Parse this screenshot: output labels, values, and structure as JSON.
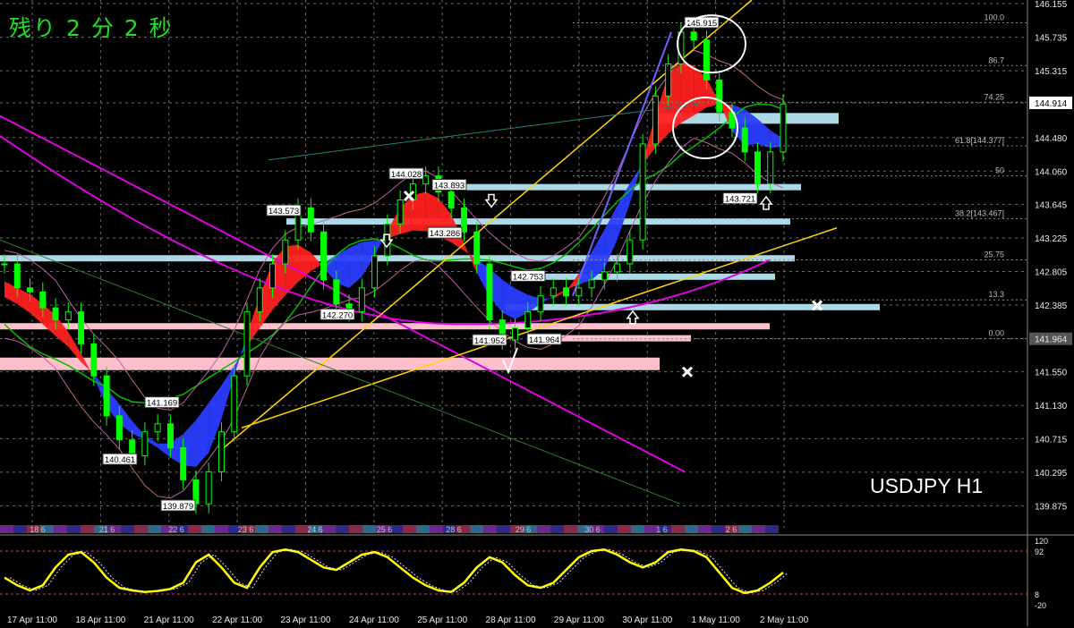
{
  "countdown": {
    "prefix": "残り",
    "minutes": "2",
    "min_unit": "分",
    "seconds": "2",
    "sec_unit": "秒"
  },
  "symbol_label": "USDJPY H1",
  "chart_data": {
    "type": "line",
    "subtype": "candlestick-with-overlays",
    "ylim": [
      139.6,
      146.2
    ],
    "y_ticks": [
      "146.155",
      "145.735",
      "145.315",
      "144.914",
      "144.480",
      "144.060",
      "143.645",
      "143.225",
      "142.805",
      "142.385",
      "141.964",
      "141.550",
      "141.130",
      "140.715",
      "140.295",
      "139.875"
    ],
    "current_price": "144.914",
    "level_price": "141.964",
    "x_tick_labels": [
      "17 Apr 11:00",
      "18 Apr 11:00",
      "21 Apr 11:00",
      "22 Apr 11:00",
      "23 Apr 11:00",
      "24 Apr 11:00",
      "25 Apr 11:00",
      "28 Apr 11:00",
      "29 Apr 11:00",
      "30 Apr 11:00",
      "1 May 11:00",
      "2 May 11:00"
    ],
    "day_markers": [
      "18 6",
      "21 6",
      "22 6",
      "23 6",
      "24 6",
      "25 6",
      "28 6",
      "29 6",
      "30 6",
      "1 6",
      "2 6"
    ],
    "fib_levels": [
      {
        "label": "100.0",
        "price": 145.915
      },
      {
        "label": "86.7",
        "price": 145.38
      },
      {
        "label": "74.25",
        "price": 144.92
      },
      {
        "label": "61.8[144.377]",
        "price": 144.377
      },
      {
        "label": "50",
        "price": 144.0
      },
      {
        "label": "38.2[143.467]",
        "price": 143.467
      },
      {
        "label": "25.75",
        "price": 142.95
      },
      {
        "label": "13.3",
        "price": 142.45
      },
      {
        "label": "0.00",
        "price": 141.964
      }
    ],
    "price_labels": [
      {
        "label": "145.915",
        "price": 145.92
      },
      {
        "label": "144.028",
        "price": 144.03
      },
      {
        "label": "143.893",
        "price": 143.89
      },
      {
        "label": "143.573",
        "price": 143.57
      },
      {
        "label": "143.286",
        "price": 143.29
      },
      {
        "label": "143.721",
        "price": 143.72
      },
      {
        "label": "142.753",
        "price": 142.75
      },
      {
        "label": "142.270",
        "price": 142.27
      },
      {
        "label": "141.952",
        "price": 141.95
      },
      {
        "label": "141.964",
        "price": 141.96
      },
      {
        "label": "141.169",
        "price": 141.17
      },
      {
        "label": "140.461",
        "price": 140.46
      },
      {
        "label": "139.879",
        "price": 139.88
      }
    ],
    "closes": [
      142.9,
      142.6,
      142.55,
      142.35,
      142.2,
      142.3,
      141.9,
      141.5,
      141.0,
      140.7,
      140.5,
      140.8,
      140.9,
      140.6,
      140.2,
      139.9,
      140.3,
      140.8,
      141.5,
      142.3,
      142.6,
      142.9,
      143.2,
      143.6,
      143.3,
      142.7,
      142.4,
      142.3,
      142.6,
      143.0,
      143.4,
      143.7,
      143.9,
      144.0,
      143.8,
      143.6,
      143.3,
      142.9,
      142.2,
      141.95,
      142.1,
      142.3,
      142.5,
      142.6,
      142.5,
      142.6,
      142.7,
      142.8,
      142.9,
      143.2,
      144.4,
      145.0,
      145.4,
      145.8,
      145.7,
      145.2,
      144.8,
      144.6,
      144.3,
      143.9,
      144.3,
      144.9
    ],
    "oscillator": {
      "ylim": [
        -20,
        120
      ],
      "levels": [
        92,
        8
      ],
      "tick_labels": [
        "120",
        "92",
        "8",
        "-20"
      ],
      "values": [
        40,
        25,
        15,
        25,
        60,
        85,
        90,
        70,
        40,
        20,
        15,
        12,
        14,
        18,
        30,
        70,
        85,
        60,
        30,
        20,
        60,
        90,
        95,
        90,
        75,
        60,
        55,
        70,
        85,
        90,
        80,
        60,
        40,
        25,
        15,
        12,
        30,
        60,
        80,
        70,
        45,
        25,
        20,
        30,
        55,
        80,
        92,
        95,
        85,
        70,
        60,
        70,
        90,
        95,
        92,
        80,
        50,
        20,
        10,
        15,
        30,
        50
      ]
    }
  }
}
